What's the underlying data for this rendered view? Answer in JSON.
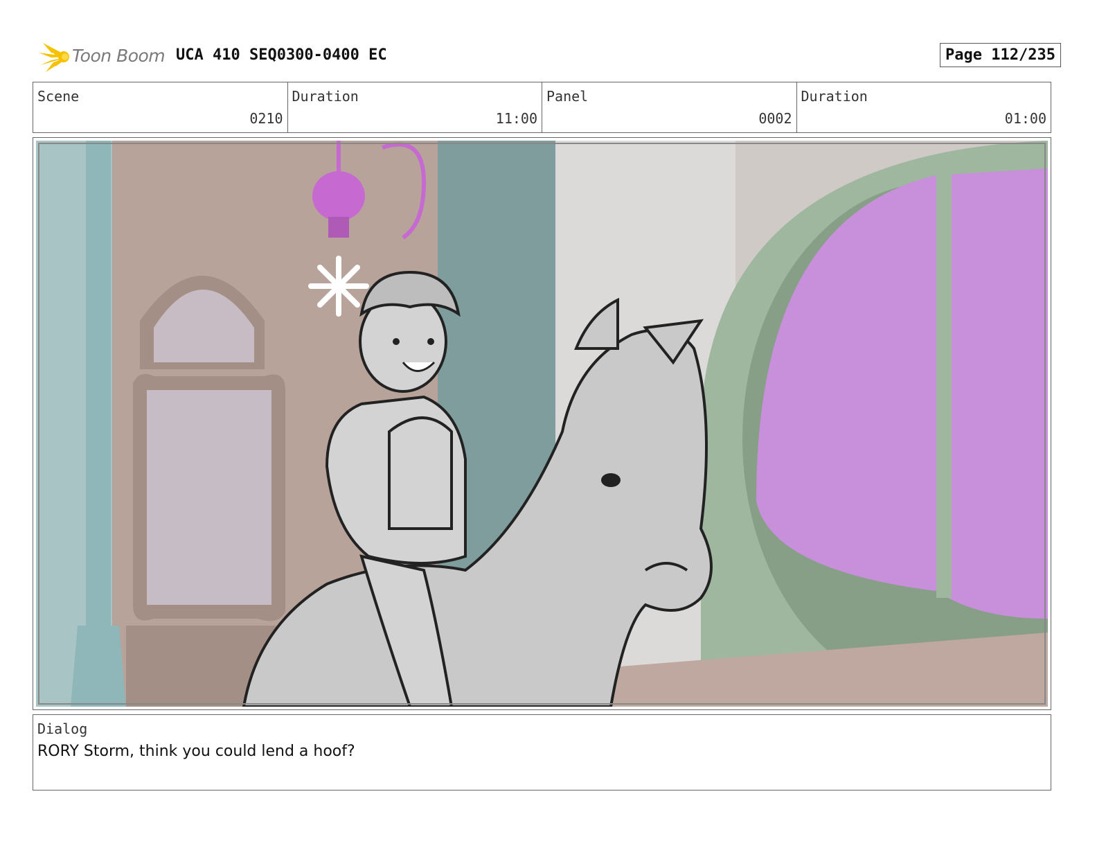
{
  "header": {
    "logo_text": "Toon Boom",
    "title": "UCA 410 SEQ0300-0400 EC",
    "page": "Page 112/235"
  },
  "info": [
    {
      "label": "Scene",
      "value": "0210"
    },
    {
      "label": "Duration",
      "value": "11:00"
    },
    {
      "label": "Panel",
      "value": "0002"
    },
    {
      "label": "Duration",
      "value": "01:00"
    }
  ],
  "dialog": {
    "label": "Dialog",
    "text": "RORY Storm, think you could lend a hoof?"
  },
  "colors": {
    "logo_yellow": "#f5c200",
    "window_purple": "#c88fdb",
    "lamp_magenta": "#c66ad1",
    "arch_green": "#9fb79f",
    "wall_tan": "#b59f94",
    "pillar_teal": "#8fb7b9"
  }
}
